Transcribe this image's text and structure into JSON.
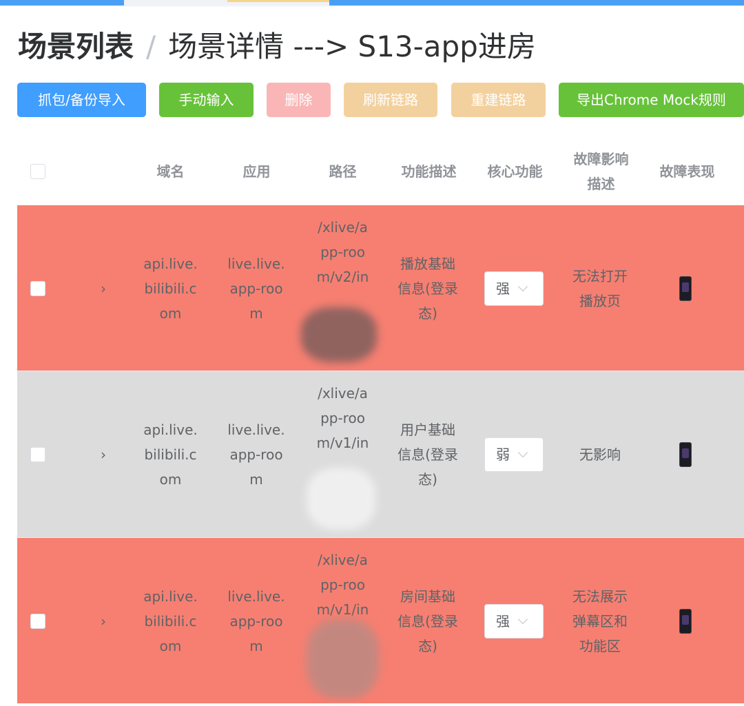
{
  "breadcrumb": {
    "item1": "场景列表",
    "separator": "/",
    "item2": "场景详情 ---> S13-app进房"
  },
  "toolbar": {
    "import_label": "抓包/备份导入",
    "manual_label": "手动输入",
    "delete_label": "删除",
    "refresh_label": "刷新链路",
    "rebuild_label": "重建链路",
    "export_label": "导出Chrome Mock规则"
  },
  "table": {
    "headers": {
      "domain": "域名",
      "app": "应用",
      "path": "路径",
      "func_desc": "功能描述",
      "core_func": "核心功能",
      "impact_desc": "故障影响描述",
      "symptom": "故障表现"
    },
    "rows": [
      {
        "domain": "api.live.bilibili.com",
        "app": "live.live.app-room",
        "path": "/xlive/app-room/v2/in",
        "func_desc": "播放基础信息(登录态)",
        "core_func": "强",
        "impact": "无法打开播放页"
      },
      {
        "domain": "api.live.bilibili.com",
        "app": "live.live.app-room",
        "path": "/xlive/app-room/v1/in",
        "func_desc": "用户基础信息(登录态)",
        "core_func": "弱",
        "impact": "无影响"
      },
      {
        "domain": "api.live.bilibili.com",
        "app": "live.live.app-room",
        "path": "/xlive/app-room/v1/in",
        "func_desc": "房间基础信息(登录态)",
        "core_func": "强",
        "impact": "无法展示弹幕区和功能区"
      }
    ]
  },
  "colors": {
    "strong_row": "#f67f71",
    "weak_row": "#dcdcdc",
    "primary": "#409eff",
    "success": "#67c23a"
  },
  "icons": {
    "expand": "chevron-right-icon",
    "select_arrow": "chevron-down-icon",
    "screenshot": "phone-screenshot-thumbnail"
  }
}
